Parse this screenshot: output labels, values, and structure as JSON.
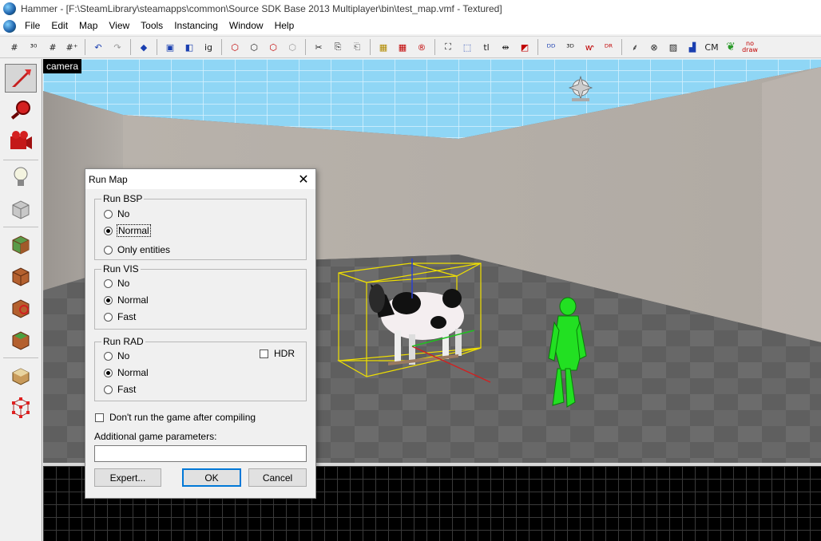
{
  "window": {
    "title": "Hammer - [F:\\SteamLibrary\\steamapps\\common\\Source SDK Base 2013 Multiplayer\\bin\\test_map.vmf - Textured]"
  },
  "menu": [
    "File",
    "Edit",
    "Map",
    "View",
    "Tools",
    "Instancing",
    "Window",
    "Help"
  ],
  "toolbar": {
    "items": [
      {
        "icon": "grid-toggle-icon",
        "glyph": "#"
      },
      {
        "icon": "3d-grid-icon",
        "glyph": "³⁰"
      },
      {
        "icon": "smaller-grid-icon",
        "glyph": "#"
      },
      {
        "icon": "larger-grid-icon",
        "glyph": "#⁺"
      },
      {
        "icon": "undo-icon",
        "glyph": "↶"
      },
      {
        "icon": "redo-icon",
        "glyph": "↷"
      },
      {
        "icon": "carve-icon",
        "glyph": "◆"
      },
      {
        "icon": "group-icon",
        "glyph": "▣"
      },
      {
        "icon": "ungroup-icon",
        "glyph": "◧"
      },
      {
        "icon": "ignore-groups-icon",
        "glyph": "ig"
      },
      {
        "icon": "hide-selected-icon",
        "glyph": "⬡"
      },
      {
        "icon": "hide-unselected-icon",
        "glyph": "⬡"
      },
      {
        "icon": "unhide-icon",
        "glyph": "⬡"
      },
      {
        "icon": "visgroup-icon",
        "glyph": "⬡"
      },
      {
        "icon": "cut-icon",
        "glyph": "✂"
      },
      {
        "icon": "copy-icon",
        "glyph": "⎘"
      },
      {
        "icon": "paste-icon",
        "glyph": "⎗"
      },
      {
        "icon": "toggle-texture-lock-icon",
        "glyph": "▦"
      },
      {
        "icon": "texture-scaling-lock-icon",
        "glyph": "▦"
      },
      {
        "icon": "radius-culling-icon",
        "glyph": "®"
      },
      {
        "icon": "helpers-icon",
        "glyph": "⛶"
      },
      {
        "icon": "select-by-handles-icon",
        "glyph": "⬚"
      },
      {
        "icon": "toolbar-tl-icon",
        "glyph": "tl"
      },
      {
        "icon": "flip-horizontal-icon",
        "glyph": "⇹"
      },
      {
        "icon": "flip-vertical-icon",
        "glyph": "◩"
      },
      {
        "icon": "2d-models-icon",
        "glyph": "ᴰᴰ"
      },
      {
        "icon": "3d-models-icon",
        "glyph": "³ᴰ"
      },
      {
        "icon": "hide-items-icon",
        "glyph": "ⱳ"
      },
      {
        "icon": "show-items-icon",
        "glyph": "ᴰᴿ"
      },
      {
        "icon": "split-icon",
        "glyph": "⸙"
      },
      {
        "icon": "entity-report-icon",
        "glyph": "⊗"
      },
      {
        "icon": "texture-browser-icon",
        "glyph": "▨"
      },
      {
        "icon": "workspace-icon",
        "glyph": "▟"
      },
      {
        "icon": "cordon-label",
        "glyph": "CM"
      },
      {
        "icon": "leaf-icon",
        "glyph": "❦"
      },
      {
        "icon": "no-draw-icon",
        "glyph": "no draw"
      }
    ]
  },
  "left_tools": [
    "selection-tool-icon",
    "magnify-tool-icon",
    "camera-tool-icon",
    "entity-tool-icon",
    "block-tool-icon",
    "texture-application-icon",
    "apply-current-texture-icon",
    "decal-tool-icon",
    "overlay-tool-icon",
    "clipping-tool-icon",
    "vertex-tool-icon"
  ],
  "viewport": {
    "label": "camera"
  },
  "dialog": {
    "title": "Run Map",
    "close_icon": "✕",
    "bsp": {
      "label": "Run BSP",
      "options": [
        "No",
        "Normal",
        "Only entities"
      ],
      "selected": "Normal"
    },
    "vis": {
      "label": "Run VIS",
      "options": [
        "No",
        "Normal",
        "Fast"
      ],
      "selected": "Normal"
    },
    "rad": {
      "label": "Run RAD",
      "options": [
        "No",
        "Normal",
        "Fast"
      ],
      "selected": "Normal",
      "hdr_label": "HDR"
    },
    "dont_run_label": "Don't run the game after compiling",
    "params_label": "Additional game parameters:",
    "params_value": "",
    "expert_label": "Expert...",
    "ok_label": "OK",
    "cancel_label": "Cancel"
  }
}
